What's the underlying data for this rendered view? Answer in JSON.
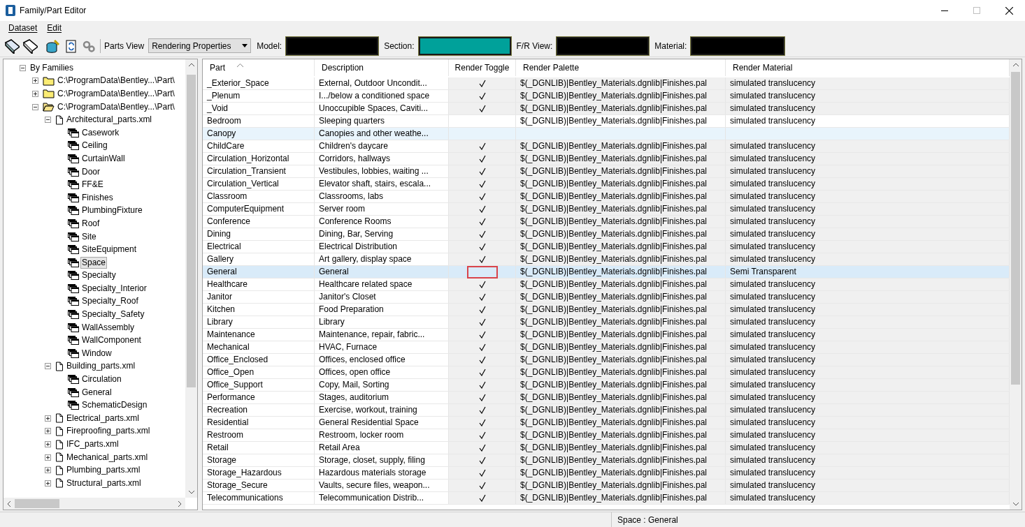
{
  "window": {
    "title": "Family/Part Editor"
  },
  "menu": [
    "Dataset",
    "Edit"
  ],
  "toolbar": {
    "parts_view_label": "Parts View",
    "parts_view_value": "Rendering Properties",
    "fields": [
      {
        "label": "Model:",
        "color": "#000000"
      },
      {
        "label": "Section:",
        "color": "#00a19a"
      },
      {
        "label": "F/R View:",
        "color": "#000000"
      },
      {
        "label": "Material:",
        "color": "#000000"
      }
    ]
  },
  "tree": [
    {
      "label": "By Families",
      "expanded": true,
      "selected": false,
      "children": [
        {
          "label": "C:\\ProgramData\\Bentley...\\Part\\",
          "kind": "folder",
          "expanded": false,
          "selected": false
        },
        {
          "label": "C:\\ProgramData\\Bentley...\\Part\\",
          "kind": "folder",
          "expanded": false,
          "selected": false
        },
        {
          "label": "C:\\ProgramData\\Bentley...\\Part\\",
          "kind": "folder",
          "expanded": true,
          "selected": false,
          "children": [
            {
              "label": "Architectural_parts.xml",
              "kind": "file",
              "expanded": true,
              "selected": false,
              "children": [
                {
                  "label": "Casework",
                  "kind": "family",
                  "selected": false
                },
                {
                  "label": "Ceiling",
                  "kind": "family",
                  "selected": false
                },
                {
                  "label": "CurtainWall",
                  "kind": "family",
                  "selected": false
                },
                {
                  "label": "Door",
                  "kind": "family",
                  "selected": false
                },
                {
                  "label": "FF&E",
                  "kind": "family",
                  "selected": false
                },
                {
                  "label": "Finishes",
                  "kind": "family",
                  "selected": false
                },
                {
                  "label": "PlumbingFixture",
                  "kind": "family",
                  "selected": false
                },
                {
                  "label": "Roof",
                  "kind": "family",
                  "selected": false
                },
                {
                  "label": "Site",
                  "kind": "family",
                  "selected": false
                },
                {
                  "label": "SiteEquipment",
                  "kind": "family",
                  "selected": false
                },
                {
                  "label": "Space",
                  "kind": "family",
                  "selected": true
                },
                {
                  "label": "Specialty",
                  "kind": "family",
                  "selected": false
                },
                {
                  "label": "Specialty_Interior",
                  "kind": "family",
                  "selected": false
                },
                {
                  "label": "Specialty_Roof",
                  "kind": "family",
                  "selected": false
                },
                {
                  "label": "Specialty_Safety",
                  "kind": "family",
                  "selected": false
                },
                {
                  "label": "WallAssembly",
                  "kind": "family",
                  "selected": false
                },
                {
                  "label": "WallComponent",
                  "kind": "family",
                  "selected": false
                },
                {
                  "label": "Window",
                  "kind": "family",
                  "selected": false
                }
              ]
            },
            {
              "label": "Building_parts.xml",
              "kind": "file",
              "expanded": true,
              "selected": false,
              "children": [
                {
                  "label": "Circulation",
                  "kind": "family",
                  "selected": false
                },
                {
                  "label": "General",
                  "kind": "family",
                  "selected": false
                },
                {
                  "label": "SchematicDesign",
                  "kind": "family",
                  "selected": false
                }
              ]
            },
            {
              "label": "Electrical_parts.xml",
              "kind": "file",
              "expanded": false,
              "selected": false
            },
            {
              "label": "Fireproofing_parts.xml",
              "kind": "file",
              "expanded": false,
              "selected": false
            },
            {
              "label": "IFC_parts.xml",
              "kind": "file",
              "expanded": false,
              "selected": false
            },
            {
              "label": "Mechanical_parts.xml",
              "kind": "file",
              "expanded": false,
              "selected": false
            },
            {
              "label": "Plumbing_parts.xml",
              "kind": "file",
              "expanded": false,
              "selected": false
            },
            {
              "label": "Structural_parts.xml",
              "kind": "file",
              "expanded": false,
              "selected": false
            }
          ]
        }
      ]
    }
  ],
  "table": {
    "columns": [
      "Part",
      "Description",
      "Render Toggle",
      "Render Palette",
      "Render Material"
    ],
    "rows": [
      {
        "part": "_Exterior_Space",
        "description": "External, Outdoor Uncondit...",
        "checked": true,
        "palette": "$(_DGNLIB)|Bentley_Materials.dgnlib|Finishes.pal",
        "material": "simulated translucency",
        "selected": false,
        "hovered": false,
        "flagged": false,
        "plain": false
      },
      {
        "part": "_Plenum",
        "description": "I.../below a conditioned space",
        "checked": true,
        "palette": "$(_DGNLIB)|Bentley_Materials.dgnlib|Finishes.pal",
        "material": "simulated translucency",
        "selected": false,
        "hovered": false,
        "flagged": false,
        "plain": false
      },
      {
        "part": "_Void",
        "description": "Unoccupible Spaces, Caviti...",
        "checked": true,
        "palette": "$(_DGNLIB)|Bentley_Materials.dgnlib|Finishes.pal",
        "material": "simulated translucency",
        "selected": false,
        "hovered": false,
        "flagged": false,
        "plain": false
      },
      {
        "part": "Bedroom",
        "description": "Sleeping quarters",
        "checked": false,
        "palette": "$(_DGNLIB)|Bentley_Materials.dgnlib|Finishes.pal",
        "material": "simulated translucency",
        "selected": false,
        "hovered": false,
        "flagged": false,
        "plain": true
      },
      {
        "part": "Canopy",
        "description": "Canopies and other weathe...",
        "checked": false,
        "selected": false,
        "hovered": true,
        "flagged": false,
        "plain": false
      },
      {
        "part": "ChildCare",
        "description": "Children's daycare",
        "checked": true,
        "palette": "$(_DGNLIB)|Bentley_Materials.dgnlib|Finishes.pal",
        "material": "simulated translucency",
        "selected": false,
        "hovered": false,
        "flagged": false,
        "plain": false
      },
      {
        "part": "Circulation_Horizontal",
        "description": "Corridors, hallways",
        "checked": true,
        "palette": "$(_DGNLIB)|Bentley_Materials.dgnlib|Finishes.pal",
        "material": "simulated translucency",
        "selected": false,
        "hovered": false,
        "flagged": false,
        "plain": false
      },
      {
        "part": "Circulation_Transient",
        "description": "Vestibules, lobbies, waiting ...",
        "checked": true,
        "palette": "$(_DGNLIB)|Bentley_Materials.dgnlib|Finishes.pal",
        "material": "simulated translucency",
        "selected": false,
        "hovered": false,
        "flagged": false,
        "plain": false
      },
      {
        "part": "Circulation_Vertical",
        "description": "Elevator shaft, stairs, escala...",
        "checked": true,
        "palette": "$(_DGNLIB)|Bentley_Materials.dgnlib|Finishes.pal",
        "material": "simulated translucency",
        "selected": false,
        "hovered": false,
        "flagged": false,
        "plain": false
      },
      {
        "part": "Classroom",
        "description": "Classrooms, labs",
        "checked": true,
        "palette": "$(_DGNLIB)|Bentley_Materials.dgnlib|Finishes.pal",
        "material": "simulated translucency",
        "selected": false,
        "hovered": false,
        "flagged": false,
        "plain": false
      },
      {
        "part": "ComputerEquipment",
        "description": "Server room",
        "checked": true,
        "palette": "$(_DGNLIB)|Bentley_Materials.dgnlib|Finishes.pal",
        "material": "simulated translucency",
        "selected": false,
        "hovered": false,
        "flagged": false,
        "plain": false
      },
      {
        "part": "Conference",
        "description": "Conference Rooms",
        "checked": true,
        "palette": "$(_DGNLIB)|Bentley_Materials.dgnlib|Finishes.pal",
        "material": "simulated translucency",
        "selected": false,
        "hovered": false,
        "flagged": false,
        "plain": false
      },
      {
        "part": "Dining",
        "description": "Dining, Bar, Serving",
        "checked": true,
        "palette": "$(_DGNLIB)|Bentley_Materials.dgnlib|Finishes.pal",
        "material": "simulated translucency",
        "selected": false,
        "hovered": false,
        "flagged": false,
        "plain": false
      },
      {
        "part": "Electrical",
        "description": "Electrical Distribution",
        "checked": true,
        "palette": "$(_DGNLIB)|Bentley_Materials.dgnlib|Finishes.pal",
        "material": "simulated translucency",
        "selected": false,
        "hovered": false,
        "flagged": false,
        "plain": false
      },
      {
        "part": "Gallery",
        "description": "Art gallery, display space",
        "checked": true,
        "palette": "$(_DGNLIB)|Bentley_Materials.dgnlib|Finishes.pal",
        "material": "simulated translucency",
        "selected": false,
        "hovered": false,
        "flagged": false,
        "plain": false
      },
      {
        "part": "General",
        "description": "General",
        "checked": false,
        "palette": "$(_DGNLIB)|Bentley_Materials.dgnlib|Finishes.pal",
        "material": "Semi Transparent",
        "selected": true,
        "hovered": false,
        "flagged": true,
        "plain": false
      },
      {
        "part": "Healthcare",
        "description": "Healthcare related space",
        "checked": true,
        "palette": "$(_DGNLIB)|Bentley_Materials.dgnlib|Finishes.pal",
        "material": "simulated translucency",
        "selected": false,
        "hovered": false,
        "flagged": false,
        "plain": false
      },
      {
        "part": "Janitor",
        "description": "Janitor's Closet",
        "checked": true,
        "palette": "$(_DGNLIB)|Bentley_Materials.dgnlib|Finishes.pal",
        "material": "simulated translucency",
        "selected": false,
        "hovered": false,
        "flagged": false,
        "plain": false
      },
      {
        "part": "Kitchen",
        "description": "Food Preparation",
        "checked": true,
        "palette": "$(_DGNLIB)|Bentley_Materials.dgnlib|Finishes.pal",
        "material": "simulated translucency",
        "selected": false,
        "hovered": false,
        "flagged": false,
        "plain": false
      },
      {
        "part": "Library",
        "description": "Library",
        "checked": true,
        "palette": "$(_DGNLIB)|Bentley_Materials.dgnlib|Finishes.pal",
        "material": "simulated translucency",
        "selected": false,
        "hovered": false,
        "flagged": false,
        "plain": false
      },
      {
        "part": "Maintenance",
        "description": "Maintenance, repair, fabric...",
        "checked": true,
        "palette": "$(_DGNLIB)|Bentley_Materials.dgnlib|Finishes.pal",
        "material": "simulated translucency",
        "selected": false,
        "hovered": false,
        "flagged": false,
        "plain": false
      },
      {
        "part": "Mechanical",
        "description": "HVAC, Furnace",
        "checked": true,
        "palette": "$(_DGNLIB)|Bentley_Materials.dgnlib|Finishes.pal",
        "material": "simulated translucency",
        "selected": false,
        "hovered": false,
        "flagged": false,
        "plain": false
      },
      {
        "part": "Office_Enclosed",
        "description": "Offices, enclosed office",
        "checked": true,
        "palette": "$(_DGNLIB)|Bentley_Materials.dgnlib|Finishes.pal",
        "material": "simulated translucency",
        "selected": false,
        "hovered": false,
        "flagged": false,
        "plain": false
      },
      {
        "part": "Office_Open",
        "description": "Offices, open office",
        "checked": true,
        "palette": "$(_DGNLIB)|Bentley_Materials.dgnlib|Finishes.pal",
        "material": "simulated translucency",
        "selected": false,
        "hovered": false,
        "flagged": false,
        "plain": false
      },
      {
        "part": "Office_Support",
        "description": "Copy, Mail, Sorting",
        "checked": true,
        "palette": "$(_DGNLIB)|Bentley_Materials.dgnlib|Finishes.pal",
        "material": "simulated translucency",
        "selected": false,
        "hovered": false,
        "flagged": false,
        "plain": false
      },
      {
        "part": "Performance",
        "description": "Stages, auditorium",
        "checked": true,
        "palette": "$(_DGNLIB)|Bentley_Materials.dgnlib|Finishes.pal",
        "material": "simulated translucency",
        "selected": false,
        "hovered": false,
        "flagged": false,
        "plain": false
      },
      {
        "part": "Recreation",
        "description": "Exercise, workout, training",
        "checked": true,
        "palette": "$(_DGNLIB)|Bentley_Materials.dgnlib|Finishes.pal",
        "material": "simulated translucency",
        "selected": false,
        "hovered": false,
        "flagged": false,
        "plain": false
      },
      {
        "part": "Residential",
        "description": "General Residential Space",
        "checked": true,
        "palette": "$(_DGNLIB)|Bentley_Materials.dgnlib|Finishes.pal",
        "material": "simulated translucency",
        "selected": false,
        "hovered": false,
        "flagged": false,
        "plain": false
      },
      {
        "part": "Restroom",
        "description": "Restroom, locker room",
        "checked": true,
        "palette": "$(_DGNLIB)|Bentley_Materials.dgnlib|Finishes.pal",
        "material": "simulated translucency",
        "selected": false,
        "hovered": false,
        "flagged": false,
        "plain": false
      },
      {
        "part": "Retail",
        "description": "Retail Area",
        "checked": true,
        "palette": "$(_DGNLIB)|Bentley_Materials.dgnlib|Finishes.pal",
        "material": "simulated translucency",
        "selected": false,
        "hovered": false,
        "flagged": false,
        "plain": false
      },
      {
        "part": "Storage",
        "description": "Storage, closet, supply, filing",
        "checked": true,
        "palette": "$(_DGNLIB)|Bentley_Materials.dgnlib|Finishes.pal",
        "material": "simulated translucency",
        "selected": false,
        "hovered": false,
        "flagged": false,
        "plain": false
      },
      {
        "part": "Storage_Hazardous",
        "description": "Hazardous materials storage",
        "checked": true,
        "palette": "$(_DGNLIB)|Bentley_Materials.dgnlib|Finishes.pal",
        "material": "simulated translucency",
        "selected": false,
        "hovered": false,
        "flagged": false,
        "plain": false
      },
      {
        "part": "Storage_Secure",
        "description": "Vaults, secure files, weapon...",
        "checked": true,
        "palette": "$(_DGNLIB)|Bentley_Materials.dgnlib|Finishes.pal",
        "material": "simulated translucency",
        "selected": false,
        "hovered": false,
        "flagged": false,
        "plain": false
      },
      {
        "part": "Telecommunications",
        "description": "Telecommunication Distrib...",
        "checked": true,
        "palette": "$(_DGNLIB)|Bentley_Materials.dgnlib|Finishes.pal",
        "material": "simulated translucency",
        "selected": false,
        "hovered": false,
        "flagged": false,
        "plain": false
      }
    ]
  },
  "status_bar": {
    "text": "Space : General"
  }
}
